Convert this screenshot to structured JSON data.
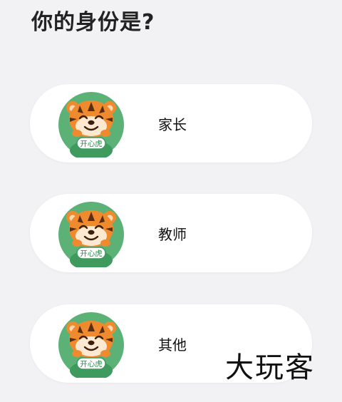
{
  "page": {
    "title": "你的身份是?"
  },
  "roles": [
    {
      "label": "家长",
      "avatar_icon": "tiger-mascot-icon",
      "badge_text": "开心虎"
    },
    {
      "label": "教师",
      "avatar_icon": "tiger-mascot-icon",
      "badge_text": "开心虎"
    },
    {
      "label": "其他",
      "avatar_icon": "tiger-mascot-icon",
      "badge_text": "开心虎"
    }
  ],
  "watermark": {
    "text": "大玩客"
  },
  "colors": {
    "background": "#f2f2f5",
    "card": "#ffffff",
    "avatar_green": "#5cb176",
    "tiger_orange": "#f08a2e"
  }
}
